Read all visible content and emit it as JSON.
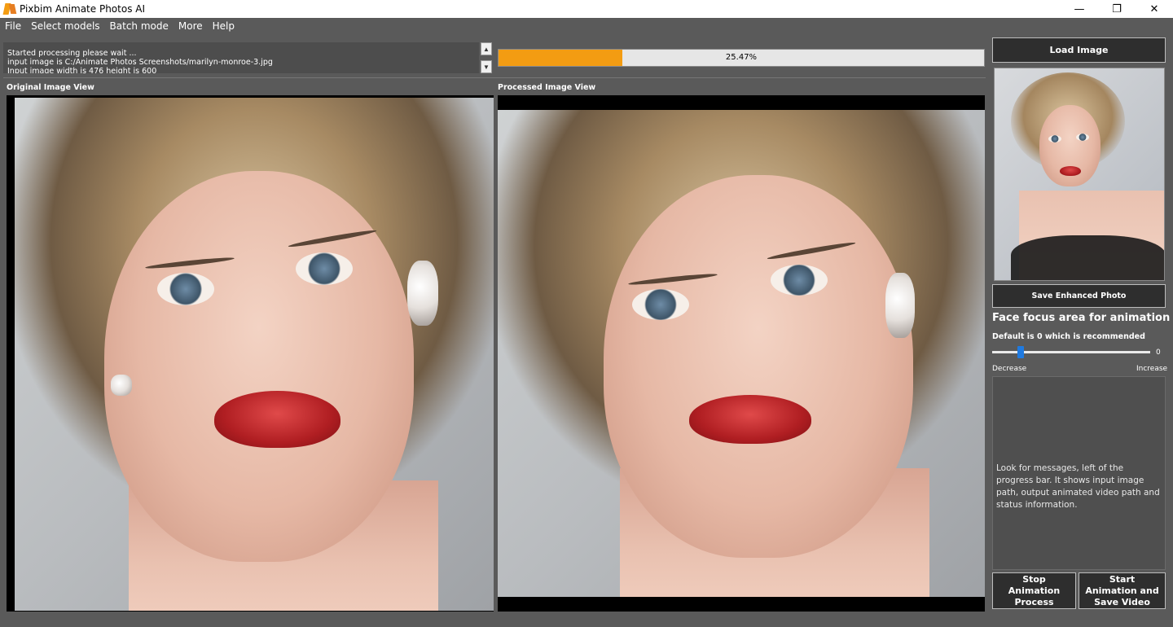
{
  "window": {
    "title": "Pixbim Animate Photos AI",
    "minimize_glyph": "—",
    "restore_glyph": "❐",
    "close_glyph": "✕"
  },
  "menu": {
    "items": [
      "File",
      "Select models",
      "Batch mode",
      "More",
      "Help"
    ]
  },
  "log": {
    "lines": [
      "Started processing please wait ...",
      "input image is C:/Animate  Photos Screenshots/marilyn-monroe-3.jpg",
      "Input image width is 476 height is 600"
    ],
    "scroll_up_glyph": "▲",
    "scroll_down_glyph": "▼"
  },
  "progress": {
    "value": 25.47,
    "label": "25.47%",
    "color": "#f39c12"
  },
  "views": {
    "original_label": "Original Image View",
    "processed_label": "Processed Image View"
  },
  "right_panel": {
    "load_button": "Load Image",
    "save_button": "Save Enhanced Photo",
    "focus_title": "Face focus area for animation",
    "focus_subtitle": "Default is 0 which is recommended",
    "slider": {
      "value": 0,
      "value_label": "0",
      "position_fraction": 0.18,
      "min_label": "Decrease",
      "max_label": "Increase"
    },
    "info_message": "Look for messages, left of the progress bar. It shows input image path, output animated video path and status information.",
    "stop_button": "Stop Animation Process",
    "start_button": "Start Animation and Save Video"
  },
  "colors": {
    "background": "#5a5a5a",
    "accent": "#f39c12",
    "slider_thumb": "#1f7ae0"
  }
}
